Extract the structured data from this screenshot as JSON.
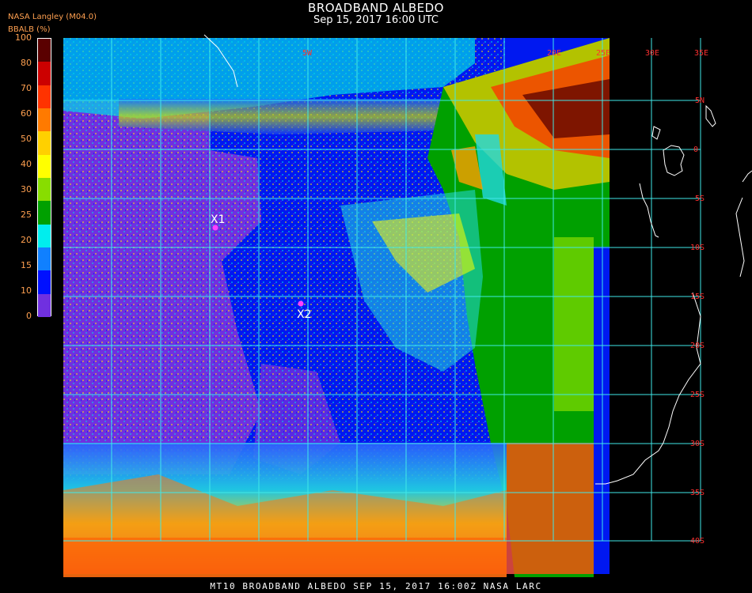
{
  "header": {
    "title": "BROADBAND ALBEDO",
    "subtitle": "Sep 15, 2017 16:00 UTC",
    "source": "NASA Langley (M04.0)",
    "units": "BBALB (%)"
  },
  "colorbar": {
    "ticks": [
      "100",
      "80",
      "70",
      "60",
      "50",
      "40",
      "30",
      "25",
      "20",
      "15",
      "10",
      "0"
    ],
    "colors": [
      "#5a0000",
      "#cc0000",
      "#ff3300",
      "#ff7a00",
      "#ffd000",
      "#ffff00",
      "#88dd00",
      "#00a000",
      "#00eeee",
      "#1080ff",
      "#0010ff",
      "#7030e0"
    ]
  },
  "lon_labels": [
    "5W",
    "20E",
    "25E",
    "30E",
    "35E"
  ],
  "lat_labels": [
    "5N",
    "0",
    "5S",
    "10S",
    "15S",
    "20S",
    "25S",
    "30S",
    "35S",
    "40S"
  ],
  "markers": [
    {
      "label": "X1",
      "color": "#ff40ff"
    },
    {
      "label": "X2",
      "color": "#ff40ff"
    }
  ],
  "footer": "MT10   BROADBAND ALBEDO   SEP 15, 2017 16:00Z   NASA LARC"
}
